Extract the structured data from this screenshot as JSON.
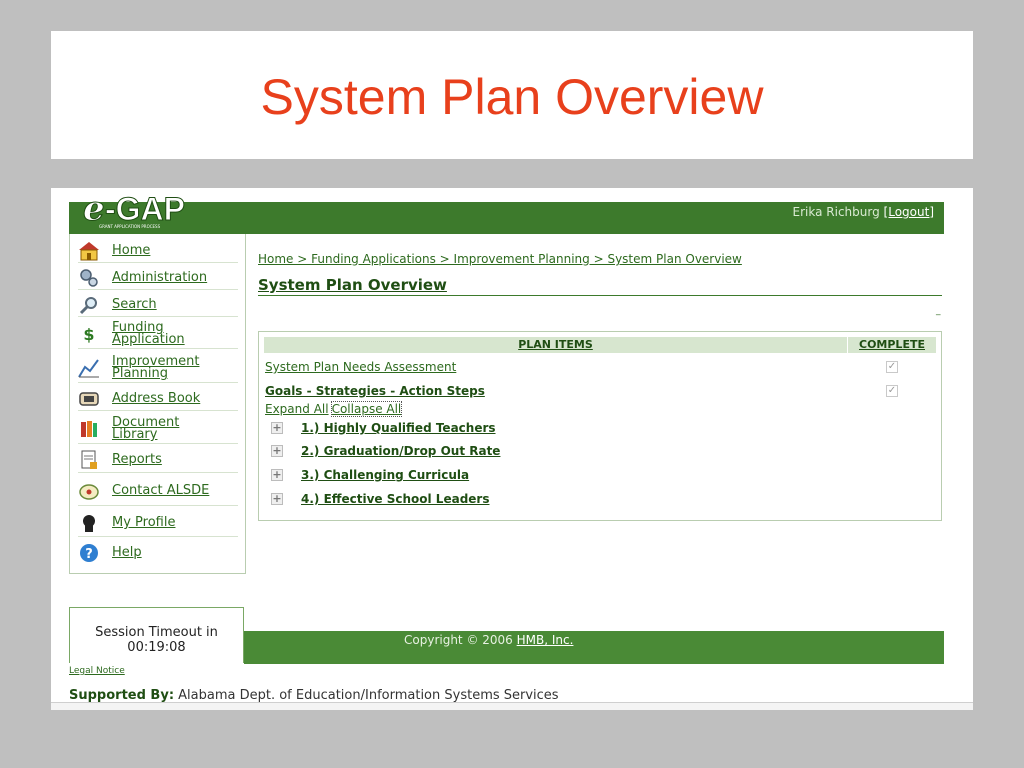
{
  "slide": {
    "title": "System Plan Overview"
  },
  "app": {
    "logo_text": "e-GAP",
    "logo_subtext": "GRANT APPLICATION PROCESS",
    "user_name": "Erika Richburg",
    "logout_label": "[Logout]"
  },
  "sidebar": {
    "items": [
      {
        "label": "Home",
        "icon": "house-icon"
      },
      {
        "label": "Administration",
        "icon": "gears-icon"
      },
      {
        "label": "Search",
        "icon": "magnifier-icon"
      },
      {
        "label": "Funding Application",
        "icon": "dollar-icon"
      },
      {
        "label": "Improvement Planning",
        "icon": "chart-icon"
      },
      {
        "label": "Address Book",
        "icon": "address-book-icon"
      },
      {
        "label": "Document Library",
        "icon": "books-icon"
      },
      {
        "label": "Reports",
        "icon": "report-icon"
      },
      {
        "label": "Contact ALSDE",
        "icon": "contact-icon"
      },
      {
        "label": "My Profile",
        "icon": "profile-icon"
      },
      {
        "label": "Help",
        "icon": "help-icon"
      }
    ]
  },
  "breadcrumb": "Home > Funding Applications > Improvement Planning > System Plan Overview",
  "page_heading": "System Plan Overview",
  "tiny_link": "_",
  "plan_table": {
    "col_items": "PLAN ITEMS",
    "col_complete": "COMPLETE",
    "rows": [
      {
        "label": "System Plan Needs Assessment",
        "complete": true,
        "bold": false
      },
      {
        "label": "Goals - Strategies - Action Steps",
        "complete": true,
        "bold": true
      }
    ],
    "expand_all": "Expand All",
    "collapse_all": "Collapse All",
    "goals": [
      "1.) Highly Qualified Teachers",
      "2.) Graduation/Drop Out Rate",
      "3.) Challenging Curricula",
      "4.) Effective School Leaders"
    ]
  },
  "session": {
    "label": "Session Timeout in",
    "time": "00:19:08"
  },
  "footer": {
    "copyright": "Copyright © 2006",
    "company_link": "HMB, Inc."
  },
  "legal_notice": "Legal Notice",
  "supported": {
    "label": "Supported By:",
    "text": "Alabama Dept. of Education/Information Systems Services"
  },
  "colors": {
    "title_red": "#e8401c",
    "brand_green": "#3d7a2c",
    "link_green": "#2d6a1e"
  }
}
